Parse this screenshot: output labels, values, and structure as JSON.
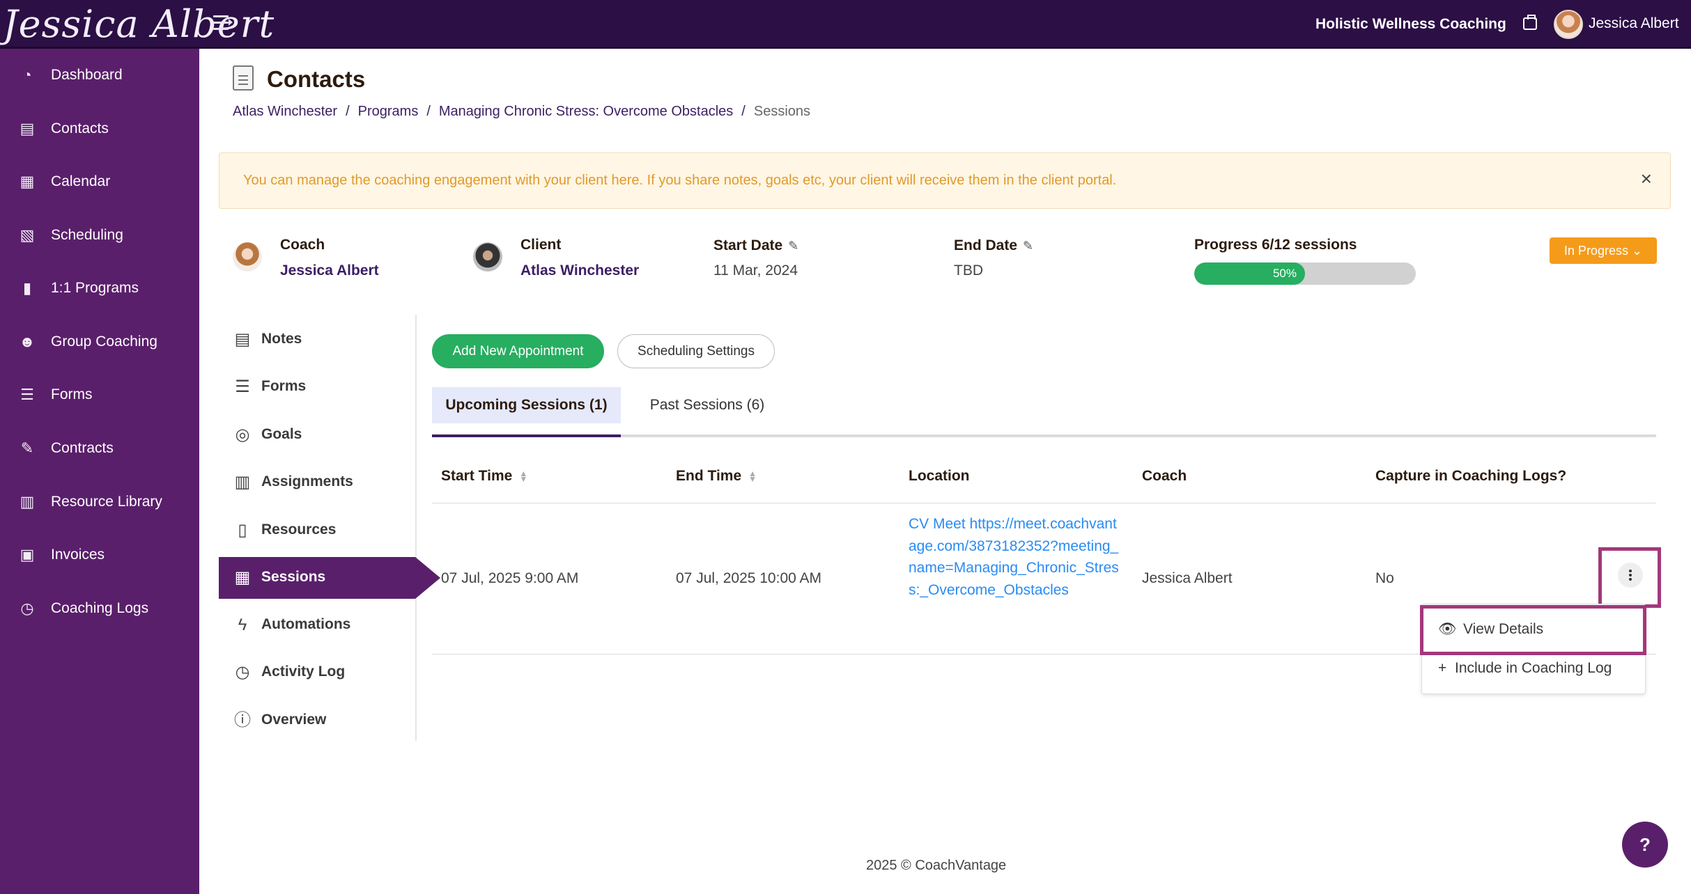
{
  "header": {
    "logo_text": "Jessica Albert",
    "business_name": "Holistic Wellness Coaching",
    "user_name": "Jessica Albert"
  },
  "sidebar": {
    "items": [
      {
        "label": "Dashboard",
        "icon": "dashboard-icon"
      },
      {
        "label": "Contacts",
        "icon": "contacts-icon"
      },
      {
        "label": "Calendar",
        "icon": "calendar-icon"
      },
      {
        "label": "Scheduling",
        "icon": "scheduling-icon"
      },
      {
        "label": "1:1 Programs",
        "icon": "book-icon"
      },
      {
        "label": "Group Coaching",
        "icon": "group-icon"
      },
      {
        "label": "Forms",
        "icon": "forms-icon"
      },
      {
        "label": "Contracts",
        "icon": "contract-icon"
      },
      {
        "label": "Resource Library",
        "icon": "library-icon"
      },
      {
        "label": "Invoices",
        "icon": "invoice-icon"
      },
      {
        "label": "Coaching Logs",
        "icon": "clock-icon"
      }
    ]
  },
  "page": {
    "title": "Contacts",
    "breadcrumb": [
      "Atlas Winchester",
      "Programs",
      "Managing Chronic Stress: Overcome Obstacles",
      "Sessions"
    ],
    "alert": "You can manage the coaching engagement with your client here. If you share notes, goals etc, your client will receive them in the client portal."
  },
  "engagement": {
    "coach_label": "Coach",
    "coach_name": "Jessica Albert",
    "client_label": "Client",
    "client_name": "Atlas Winchester",
    "start_label": "Start Date",
    "start_value": "11 Mar, 2024",
    "end_label": "End Date",
    "end_value": "TBD",
    "progress_label": "Progress 6/12 sessions",
    "progress_text": "50%",
    "progress_fraction": 0.5,
    "status": "In Progress"
  },
  "submenu": {
    "items": [
      {
        "label": "Notes",
        "icon": "notes-icon"
      },
      {
        "label": "Forms",
        "icon": "forms-icon"
      },
      {
        "label": "Goals",
        "icon": "target-icon"
      },
      {
        "label": "Assignments",
        "icon": "clipboard-icon"
      },
      {
        "label": "Resources",
        "icon": "resources-icon"
      },
      {
        "label": "Sessions",
        "icon": "calendar-icon",
        "active": true
      },
      {
        "label": "Automations",
        "icon": "bolt-icon"
      },
      {
        "label": "Activity Log",
        "icon": "history-icon"
      },
      {
        "label": "Overview",
        "icon": "info-icon"
      }
    ]
  },
  "sessions": {
    "add_button": "Add New Appointment",
    "settings_button": "Scheduling Settings",
    "tabs": [
      "Upcoming Sessions (1)",
      "Past Sessions (6)"
    ],
    "columns": [
      "Start Time",
      "End Time",
      "Location",
      "Coach",
      "Capture in Coaching Logs?"
    ],
    "rows": [
      {
        "start": "07 Jul, 2025 9:00 AM",
        "end": "07 Jul, 2025 10:00 AM",
        "location": "CV Meet https://meet.coachvantage.com/3873182352?meeting_name=Managing_Chronic_Stress:_Overcome_Obstacles",
        "coach": "Jessica Albert",
        "capture": "No"
      }
    ],
    "menu": {
      "view_details": "View Details",
      "include_log": "Include in Coaching Log"
    }
  },
  "footer": "2025 © CoachVantage",
  "help": "?",
  "colors": {
    "topbar": "#2b0f45",
    "sidebar": "#5a1f6b",
    "primary_green": "#27ae60",
    "status_orange": "#f59b1a",
    "highlight": "#a2387b",
    "link_blue": "#2a8bf2"
  }
}
